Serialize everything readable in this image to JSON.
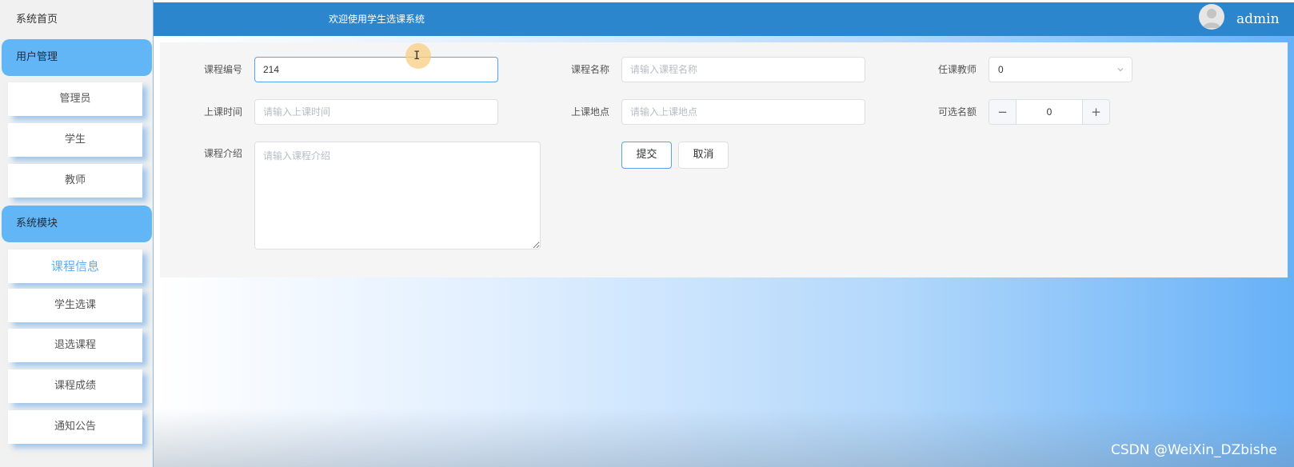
{
  "sidebar": {
    "home": "系统首页",
    "groups": [
      {
        "title": "用户管理",
        "items": [
          "管理员",
          "学生",
          "教师"
        ]
      },
      {
        "title": "系统模块",
        "items": [
          "课程信息",
          "学生选课",
          "退选课程",
          "课程成绩",
          "通知公告"
        ]
      }
    ],
    "active_item": "课程信息"
  },
  "header": {
    "title": "欢迎使用学生选课系统",
    "username": "admin",
    "avatar_icon": "user-avatar-icon"
  },
  "form": {
    "course_id": {
      "label": "课程编号",
      "value": "214",
      "placeholder": ""
    },
    "course_name": {
      "label": "课程名称",
      "value": "",
      "placeholder": "请输入课程名称"
    },
    "teacher": {
      "label": "任课教师",
      "value": "0"
    },
    "class_time": {
      "label": "上课时间",
      "value": "",
      "placeholder": "请输入上课时间"
    },
    "location": {
      "label": "上课地点",
      "value": "",
      "placeholder": "请输入上课地点"
    },
    "quota": {
      "label": "可选名额",
      "value": "0",
      "minus": "−",
      "plus": "+"
    },
    "intro": {
      "label": "课程介绍",
      "value": "",
      "placeholder": "请输入课程介绍"
    },
    "submit": "提交",
    "cancel": "取消"
  },
  "cursor": {
    "symbol": "I"
  },
  "watermark": "CSDN @WeiXin_DZbishe",
  "colors": {
    "header_bg": "#2b86cd",
    "menu_group_bg": "#62b6f6",
    "active_text": "#62aef0",
    "focus_border": "#5aa2ec"
  }
}
